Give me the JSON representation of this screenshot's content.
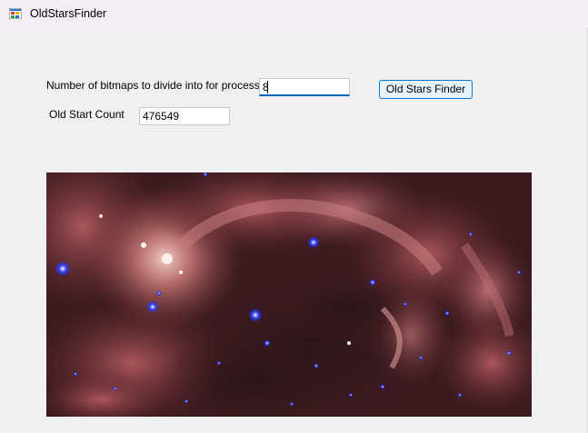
{
  "window": {
    "title": "OldStarsFinder"
  },
  "form": {
    "bitmaps_label": "Number of bitmaps to divide into for processing:",
    "bitmaps_value": "8",
    "count_label": "Old Start Count",
    "count_value": "476549",
    "find_button_label": "Old Stars Finder"
  },
  "image": {
    "description": "nebula"
  },
  "icons": [
    "app-icon"
  ],
  "colors": {
    "focus_accent": "#0067c0",
    "button_border": "#0078d4",
    "button_fill": "#e5f1fb",
    "marker_blue": "#1a2cff"
  }
}
